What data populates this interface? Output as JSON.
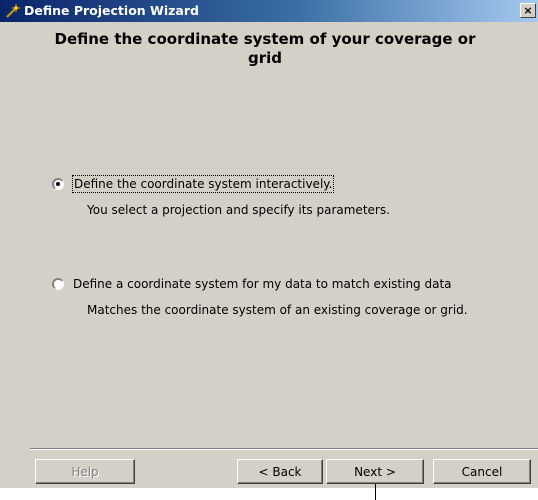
{
  "window": {
    "title": "Define Projection Wizard",
    "close_glyph": "×",
    "title_icon": "wand-icon",
    "close_icon": "close-icon"
  },
  "heading": "Define the coordinate system of your coverage or grid",
  "options": [
    {
      "label": "Define the coordinate system interactively.",
      "description": "You select a projection and specify its parameters.",
      "selected": true
    },
    {
      "label": "Define a coordinate system for my data to match existing data",
      "description": "Matches the coordinate system of an existing coverage or grid.",
      "selected": false
    }
  ],
  "buttons": {
    "help": "Help",
    "back": "< Back",
    "next": "Next >",
    "cancel": "Cancel"
  },
  "colors": {
    "title_gradient_start": "#0a246a",
    "title_gradient_end": "#a6caf0",
    "dialog_face": "#d4d0c8"
  }
}
